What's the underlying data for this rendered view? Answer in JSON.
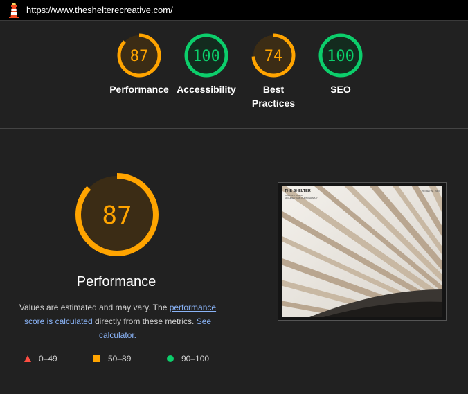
{
  "browser": {
    "url": "https://www.theshelterecreative.com/",
    "icon": "lighthouse-icon"
  },
  "scores": [
    {
      "name": "Performance",
      "label_line1": "Performance",
      "label_line2": "",
      "score": "87",
      "fraction": 0.87,
      "color": "#ffa400",
      "status": "average"
    },
    {
      "name": "Accessibility",
      "label_line1": "Accessibility",
      "label_line2": "",
      "score": "100",
      "fraction": 1.0,
      "color": "#0cce6b",
      "status": "pass"
    },
    {
      "name": "Best Practices",
      "label_line1": "Best",
      "label_line2": "Practices",
      "score": "74",
      "fraction": 0.74,
      "color": "#ffa400",
      "status": "average"
    },
    {
      "name": "SEO",
      "label_line1": "SEO",
      "label_line2": "",
      "score": "100",
      "fraction": 1.0,
      "color": "#0cce6b",
      "status": "pass"
    }
  ],
  "detail": {
    "score": "87",
    "fraction": 0.87,
    "title": "Performance",
    "desc_prefix": "Values are estimated and may vary. The ",
    "desc_link1": "performance score is calculated",
    "desc_middle": " directly from these metrics. ",
    "desc_link2": "See calculator."
  },
  "screenshot": {
    "brand": "THE SHELTER",
    "tagline_1": "CREATIVE STUDIO",
    "tagline_2": "ARCHITECTURE PHOTOGRAPHY",
    "corner": "PROJECTS · INFO"
  },
  "legend": [
    {
      "range": "0–49",
      "shape": "triangle",
      "color": "#ff4e42"
    },
    {
      "range": "50–89",
      "shape": "square",
      "color": "#ffa400"
    },
    {
      "range": "90–100",
      "shape": "circle",
      "color": "#0cce6b"
    }
  ],
  "colors": {
    "background": "#212121",
    "average": "#ffa400",
    "pass": "#0cce6b",
    "fail": "#ff4e42",
    "link": "#8ab4f8"
  }
}
